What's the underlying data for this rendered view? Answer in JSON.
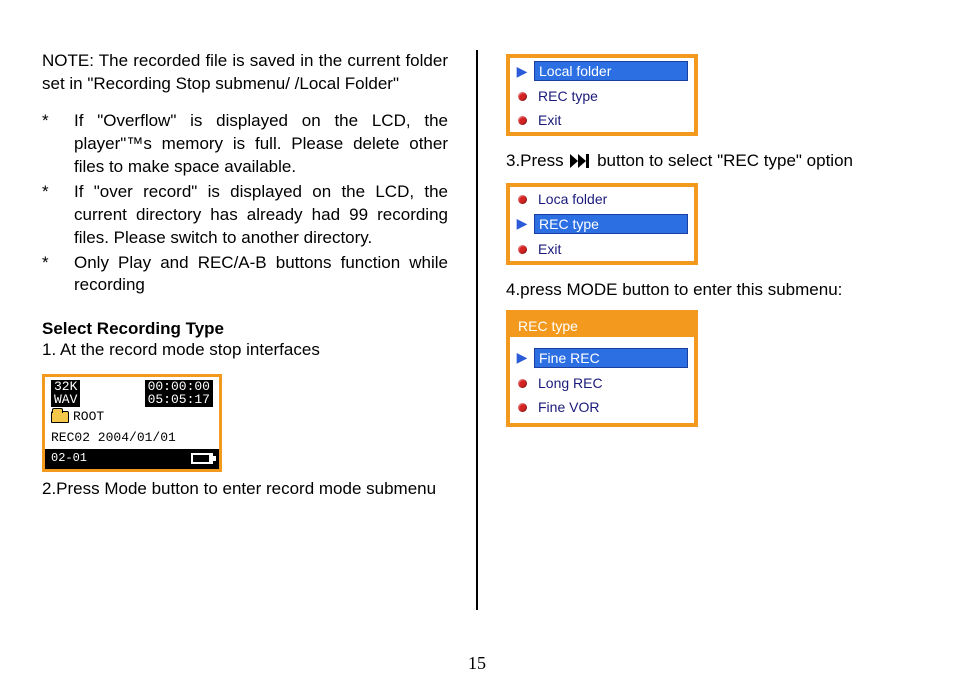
{
  "left": {
    "note": "NOTE: The recorded file is saved in the current folder set in \"Recording Stop submenu/ /Local Folder\"",
    "bullets": [
      "If \"Overflow\" is displayed on the LCD, the player\"™s memory is full. Please delete other files to make space available.",
      "If \"over record\"  is displayed on the LCD, the current directory has already had 99 recording files. Please switch to another directory.",
      "Only Play and REC/A-B buttons function while recording"
    ],
    "heading": "Select Recording Type",
    "step1": "1. At the record mode stop interfaces",
    "lcd": {
      "rate": "32K",
      "fmt": "WAV",
      "timeA": "00:00:00",
      "timeB": "05:05:17",
      "root": "ROOT",
      "rec": "REC02 2004/01/01",
      "idx": "02-01"
    },
    "step2": "2.Press Mode button to enter record mode submenu"
  },
  "right": {
    "menuA": {
      "items": [
        "Local folder",
        "REC type",
        "Exit"
      ],
      "selectedIndex": 0
    },
    "step3_pre": "3.Press ",
    "step3_post": " button to select \"REC type\" option",
    "menuB": {
      "items": [
        "Loca folder",
        "REC type",
        "Exit"
      ],
      "selectedIndex": 1
    },
    "step4": "4.press MODE button to enter this submenu:",
    "menuC": {
      "title": "REC type",
      "items": [
        "Fine REC",
        "Long REC",
        "Fine VOR"
      ],
      "selectedIndex": 0
    }
  },
  "pageNumber": "15",
  "star": "*"
}
